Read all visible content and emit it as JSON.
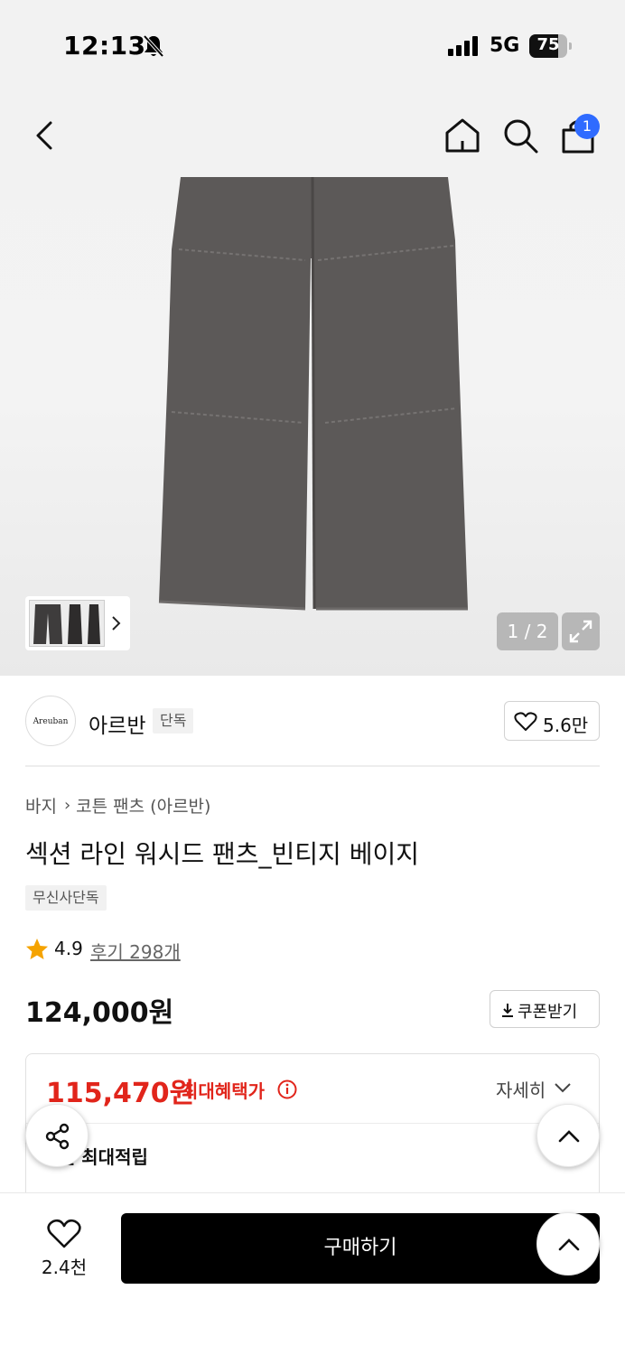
{
  "status_bar": {
    "time": "12:13",
    "network": "5G",
    "battery": "75",
    "battery_level": 0.75
  },
  "header": {
    "cart_count": "1",
    "icons": [
      "back-icon",
      "home-icon",
      "search-icon",
      "cart-icon"
    ]
  },
  "gallery": {
    "counter": "1 / 2"
  },
  "brand": {
    "logo_text": "Areuban",
    "name": "아르반",
    "tag": "단독",
    "likes": "5.6만"
  },
  "breadcrumb": {
    "level1": "바지",
    "level2": "코튼 팬츠 (아르반)"
  },
  "product": {
    "title": "섹션 라인 워시드 팬츠_빈티지 베이지",
    "exclusive_tag": "무신사단독",
    "rating": "4.9",
    "reviews": "후기 298개",
    "price": "124,000원",
    "coupon_label": "쿠폰받기"
  },
  "benefit": {
    "max_price": "115,470원",
    "max_label": "최대혜택가",
    "detail_link": "자세히",
    "points_text": "0원 최대적립"
  },
  "bottom_bar": {
    "wish_count": "2.4천",
    "buy_label": "구매하기"
  },
  "colors": {
    "accent_red": "#e1251b",
    "badge_blue": "#2f6bff",
    "star": "#f5a300"
  }
}
